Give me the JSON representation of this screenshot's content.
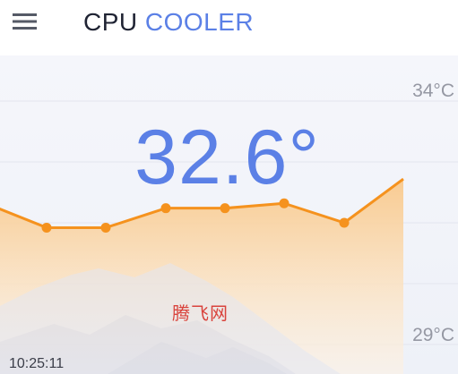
{
  "header": {
    "title_part1": "CPU",
    "title_part2": "COOLER",
    "menu_icon": "hamburger-menu-icon"
  },
  "temperature": {
    "current": "32.6°"
  },
  "watermark": "腾飞网",
  "colors": {
    "accent": "#5b80e6",
    "line": "#f5921e",
    "title_dark": "#1f2333",
    "axis_text": "#9598a3"
  },
  "chart_data": {
    "type": "area",
    "ylabels": [
      "34°C",
      "29°C"
    ],
    "ylim": [
      29,
      34
    ],
    "x_label_visible": "10:25:11",
    "series": [
      {
        "values": [
          31.9,
          31.4,
          31.4,
          31.8,
          31.8,
          31.9,
          31.5,
          32.4
        ]
      }
    ],
    "grid": true
  }
}
